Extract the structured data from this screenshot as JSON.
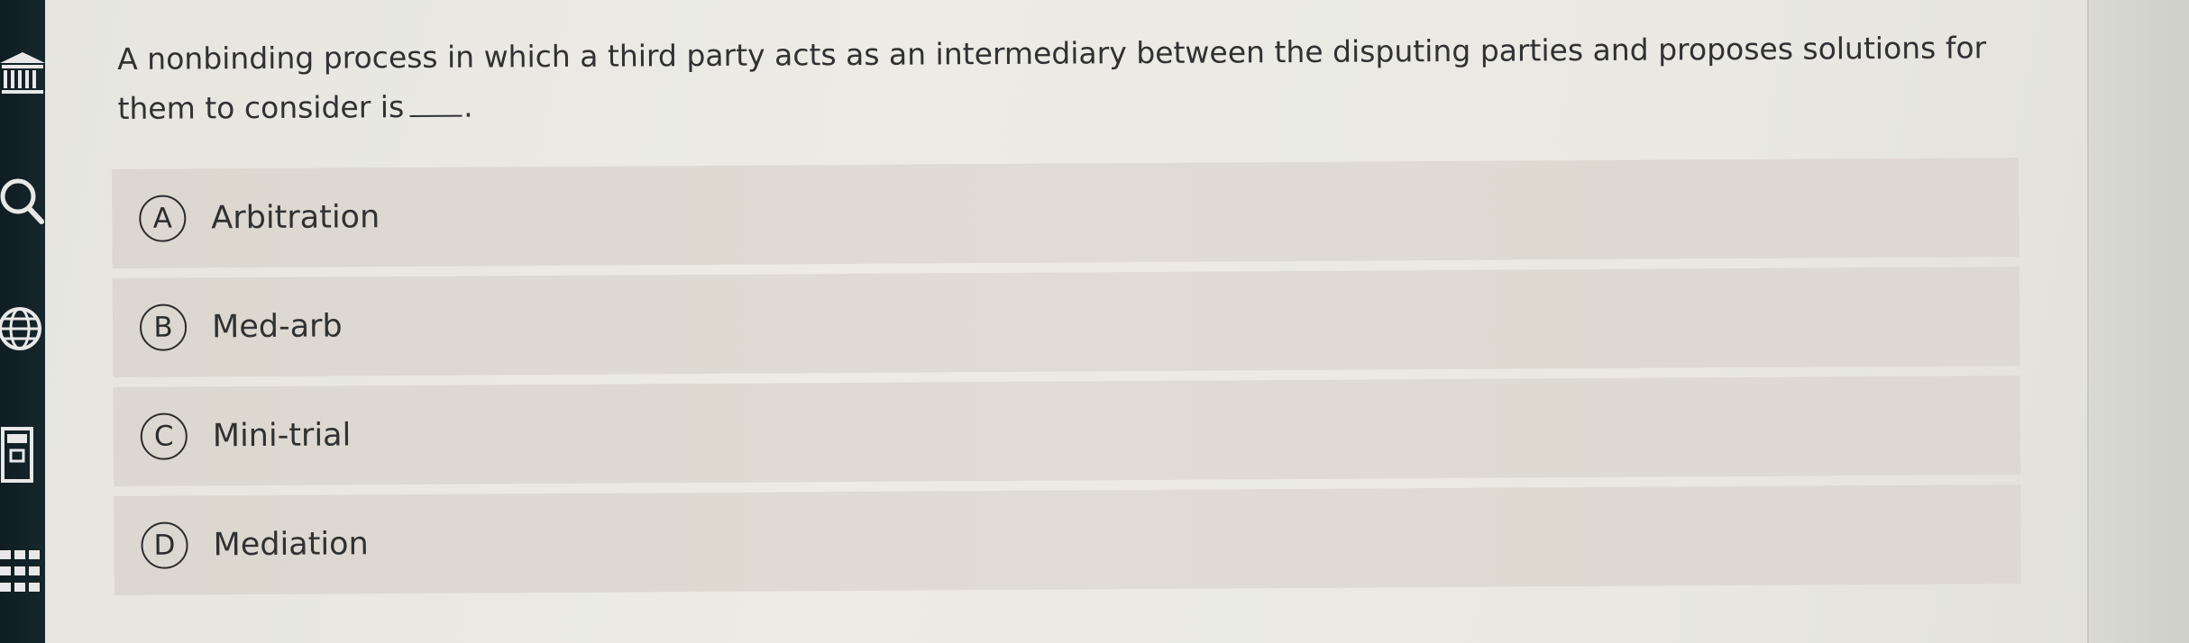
{
  "question": {
    "text": "A nonbinding process in which a third party acts as an intermediary between the disputing parties and proposes solutions for them to consider is",
    "suffix": "."
  },
  "options": [
    {
      "letter": "A",
      "label": "Arbitration"
    },
    {
      "letter": "B",
      "label": "Med-arb"
    },
    {
      "letter": "C",
      "label": "Mini-trial"
    },
    {
      "letter": "D",
      "label": "Mediation"
    }
  ],
  "sidebar": {
    "icons": [
      "institution-icon",
      "search-icon",
      "globe-icon",
      "calculator-icon",
      "apps-grid-icon"
    ]
  },
  "colors": {
    "sidebar": "#13232a",
    "option_bg": "#ded9d2",
    "text": "#2f3133"
  }
}
